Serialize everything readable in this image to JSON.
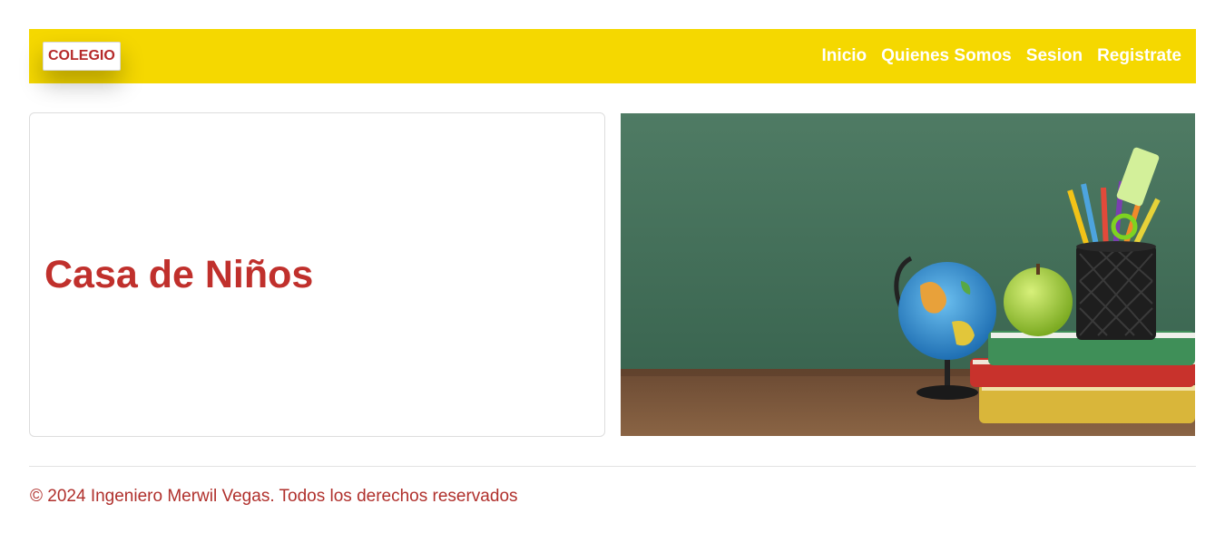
{
  "navbar": {
    "brand": "COLEGIO",
    "links": [
      "Inicio",
      "Quienes Somos",
      "Sesion",
      "Registrate"
    ],
    "background_color": "#f5d800",
    "text_color": "#ffffff"
  },
  "hero": {
    "title": "Casa de Niños",
    "title_color": "#c0302c",
    "image": {
      "subject": "school supplies on a desk in front of a green chalkboard",
      "icon": "globe, apple, books, pencil cup"
    }
  },
  "footer": {
    "text": "© 2024 Ingeniero Merwil Vegas. Todos los derechos reservados",
    "color": "#b0302c"
  }
}
